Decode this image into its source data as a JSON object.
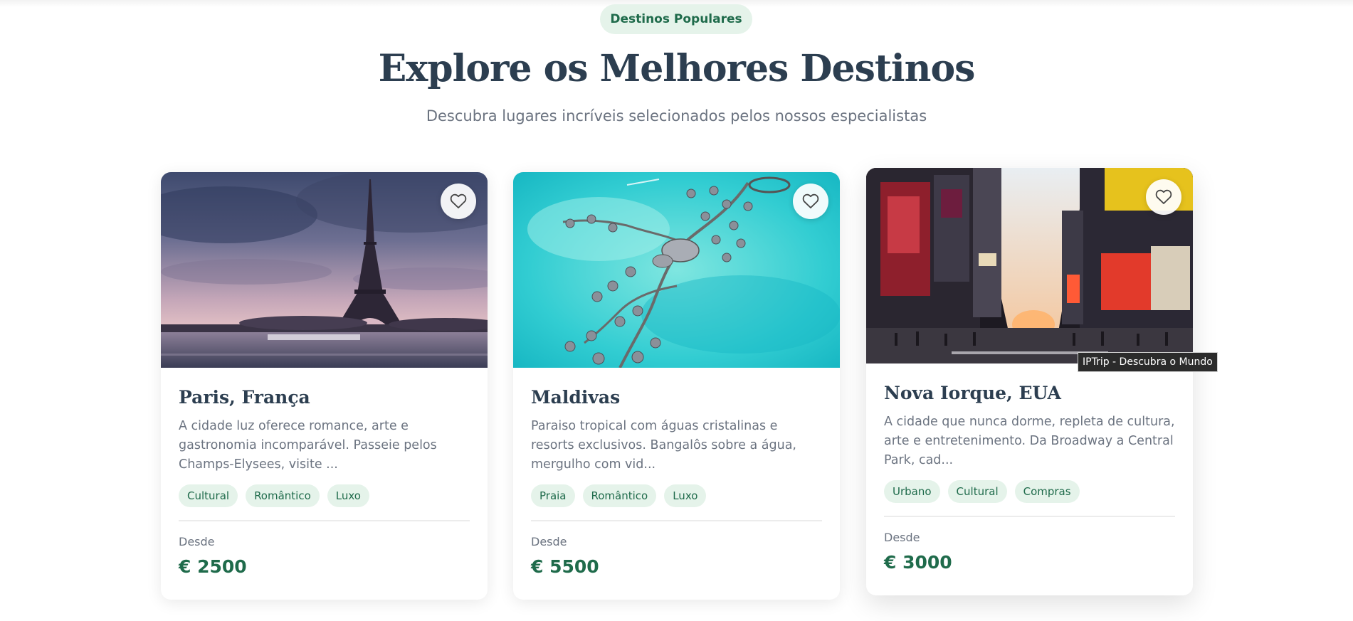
{
  "section": {
    "badge": "Destinos Populares",
    "title": "Explore os Melhores Destinos",
    "subtitle": "Descubra lugares incríveis selecionados pelos nossos especialistas"
  },
  "cards": [
    {
      "title": "Paris, França",
      "description": "A cidade luz oferece romance, arte e gastronomia incomparável. Passeie pelos Champs-Elysees, visite ...",
      "tags": [
        "Cultural",
        "Romântico",
        "Luxo"
      ],
      "price_label": "Desde",
      "price": "€ 2500",
      "favorite_icon": "heart-outline-icon"
    },
    {
      "title": "Maldivas",
      "description": "Paraiso tropical com águas cristalinas e resorts exclusivos. Bangalôs sobre a água, mergulho com vid...",
      "tags": [
        "Praia",
        "Romântico",
        "Luxo"
      ],
      "price_label": "Desde",
      "price": "€ 5500",
      "favorite_icon": "heart-outline-icon"
    },
    {
      "title": "Nova Iorque, EUA",
      "description": "A cidade que nunca dorme, repleta de cultura, arte e entretenimento. Da Broadway a Central Park, cad...",
      "tags": [
        "Urbano",
        "Cultural",
        "Compras"
      ],
      "price_label": "Desde",
      "price": "€ 3000",
      "favorite_icon": "heart-outline-icon"
    }
  ],
  "tooltip": "IPTrip - Descubra o Mundo",
  "colors": {
    "primary_green": "#1f6b4b",
    "tag_background": "#e5f3ea",
    "heading": "#2c3e50",
    "muted_text": "#6b7380"
  }
}
